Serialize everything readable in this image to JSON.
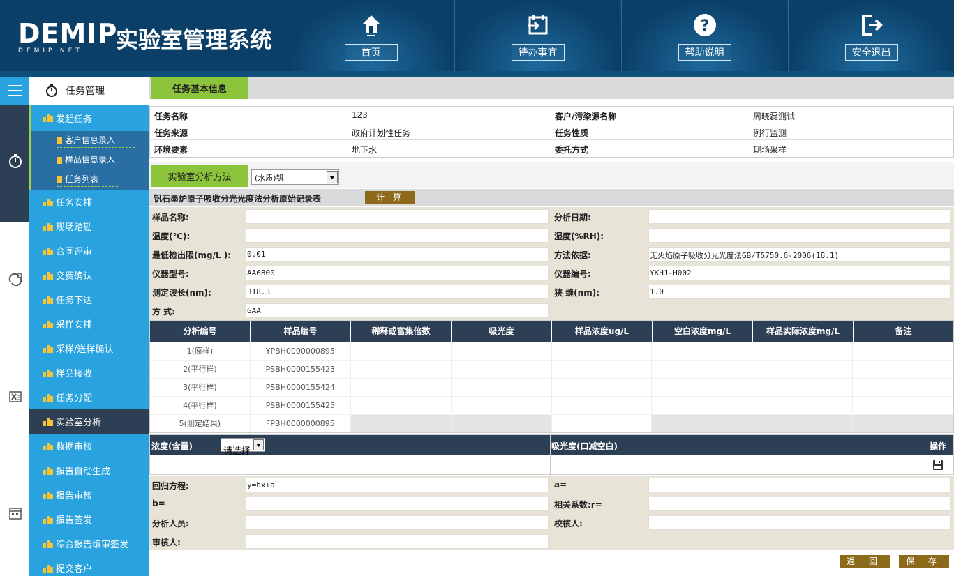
{
  "brand": {
    "logo_text": "DEMIP",
    "logo_sub": "DEMIP.NET",
    "system_title": "实验室管理系统"
  },
  "nav": [
    {
      "label": "首页",
      "icon": "home-icon"
    },
    {
      "label": "待办事宜",
      "icon": "calendar-import-icon"
    },
    {
      "label": "帮助说明",
      "icon": "help-icon"
    },
    {
      "label": "安全退出",
      "icon": "logout-icon"
    }
  ],
  "sidebar": {
    "header": "任务管理",
    "items": [
      {
        "label": "发起任务"
      },
      {
        "label": "任务安排"
      },
      {
        "label": "现场踏勘"
      },
      {
        "label": "合同评审"
      },
      {
        "label": "交费确认"
      },
      {
        "label": "任务下达"
      },
      {
        "label": "采样安排"
      },
      {
        "label": "采样/送样确认"
      },
      {
        "label": "样品接收"
      },
      {
        "label": "任务分配"
      },
      {
        "label": "实验室分析"
      },
      {
        "label": "数据审核"
      },
      {
        "label": "报告自动生成"
      },
      {
        "label": "报告审核"
      },
      {
        "label": "报告签发"
      },
      {
        "label": "综合报告编审签发"
      },
      {
        "label": "提交客户"
      }
    ],
    "subitems": [
      {
        "label": "客户信息录入"
      },
      {
        "label": "样品信息录入"
      },
      {
        "label": "任务列表"
      }
    ]
  },
  "task_info": {
    "tab_label": "任务基本信息",
    "rows": [
      {
        "l1": "任务名称",
        "v1": "123",
        "l2": "客户/污染源名称",
        "v2": "周晓磊测试"
      },
      {
        "l1": "任务来源",
        "v1": "政府计划性任务",
        "l2": "任务性质",
        "v2": "例行监测"
      },
      {
        "l1": "环境要素",
        "v1": "地下水",
        "l2": "委托方式",
        "v2": "现场采样"
      }
    ]
  },
  "method": {
    "tab_label": "实验室分析方法",
    "selected": "(水质)钒"
  },
  "record": {
    "title": "钒石墨炉原子吸收分光光度法分析原始记录表",
    "calc_label": "计 算"
  },
  "form": [
    {
      "l1": "样品名称:",
      "v1": "",
      "l2": "分析日期:",
      "v2": ""
    },
    {
      "l1": "温度(℃):",
      "v1": "",
      "l2": "湿度(%RH):",
      "v2": ""
    },
    {
      "l1": "最低检出限(mg/L ):",
      "v1": "0.01",
      "l2": "方法依据:",
      "v2": "无火焰原子吸收分光光度法GB/T5750.6-2006(18.1)"
    },
    {
      "l1": "仪器型号:",
      "v1": "AA6800",
      "l2": "仪器编号:",
      "v2": "YKHJ-H002"
    },
    {
      "l1": "测定波长(nm):",
      "v1": "318.3",
      "l2": "狭 缝(nm):",
      "v2": "1.0"
    },
    {
      "l1": "方 式:",
      "v1": "GAA",
      "l2": "",
      "v2": null
    }
  ],
  "grid": {
    "headers": [
      "分析编号",
      "样品编号",
      "稀释或富集倍数",
      "吸光度",
      "样品浓度ug/L",
      "空白浓度mg/L",
      "样品实际浓度mg/L",
      "备注"
    ],
    "rows": [
      {
        "no": "1(原样)",
        "sample": "YPBH0000000895"
      },
      {
        "no": "2(平行样)",
        "sample": "PSBH0000155423"
      },
      {
        "no": "3(平行样)",
        "sample": "PSBH0000155424"
      },
      {
        "no": "4(平行样)",
        "sample": "PSBH0000155425"
      },
      {
        "no": "5(测定结果)",
        "sample": "FPBH0000000895"
      }
    ]
  },
  "concentration": {
    "label": "浓度(含量)",
    "select": "请选择",
    "absorbance_label": "吸光度(口减空白)",
    "op_label": "操作"
  },
  "form2": [
    {
      "l1": "回归方程:",
      "v1": "y=bx+a",
      "l2": "a=",
      "v2": ""
    },
    {
      "l1": "b=",
      "v1": "",
      "l2": "相关系数:r=",
      "v2": ""
    },
    {
      "l1": "分析人员:",
      "v1": "",
      "l2": "校核人:",
      "v2": ""
    },
    {
      "l1": "审核人:",
      "v1": "",
      "l2": "",
      "v2": null
    }
  ],
  "buttons": {
    "back": "返 回",
    "save": "保 存"
  },
  "colors": {
    "header_bg": "#0b3f67",
    "sidebar_bg": "#29a3df",
    "active_bg": "#2d3f55",
    "tab_green": "#8cc43c",
    "button_brown": "#8c6a1a",
    "form_bg": "#e8e3d7"
  }
}
